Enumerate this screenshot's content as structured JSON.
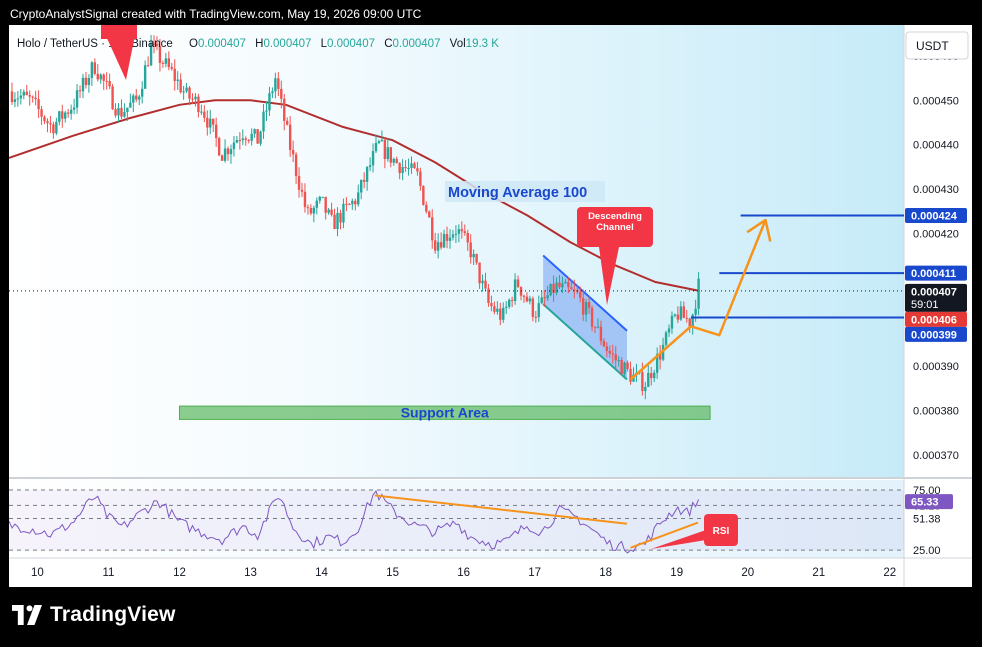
{
  "header": {
    "title": "CryptoAnalystSignal created with TradingView.com, May 19, 2026 09:00 UTC"
  },
  "legend": {
    "symbol": "Holo / TetherUS · 1h · Binance",
    "o_label": "O",
    "o": "0.000407",
    "h_label": "H",
    "h": "0.000407",
    "l_label": "L",
    "l": "0.000407",
    "c_label": "C",
    "c": "0.000407",
    "vol_label": "Vol",
    "vol": "19.3 K"
  },
  "currency": "USDT",
  "colors": {
    "up": "#26a69a",
    "down": "#ef5350",
    "ma": "#b22e2e",
    "blue": "#1848cc",
    "orange": "#f7931a",
    "support": "#66bb6a",
    "rsi": "#7e57c2",
    "callout": "#f23645",
    "bg": "#ddf1fb"
  },
  "annotations": {
    "ma_label": "Moving Average 100",
    "channel_label": "Descending Channel",
    "support_label": "Support Area",
    "rsi_label": "RSI"
  },
  "price_badges": [
    {
      "value": "0.000424",
      "kind": "blue"
    },
    {
      "value": "0.000411",
      "kind": "blue"
    },
    {
      "value": "0.000407",
      "sub": "59:01",
      "kind": "black"
    },
    {
      "value": "0.000406",
      "kind": "red"
    },
    {
      "value": "0.000399",
      "kind": "blue"
    }
  ],
  "rsi_badge": "65.33",
  "rsi_ticks": [
    "75.00",
    "62.20",
    "51.38",
    "25.00"
  ],
  "chart_data": {
    "type": "candlestick",
    "y_ticks": [
      "0.000460",
      "0.000450",
      "0.000440",
      "0.000430",
      "0.000420",
      "0.000390",
      "0.000380",
      "0.000370"
    ],
    "y_range": [
      0.000365,
      0.000467
    ],
    "x_ticks": [
      "10",
      "11",
      "12",
      "13",
      "14",
      "15",
      "16",
      "17",
      "18",
      "19",
      "20",
      "21",
      "22"
    ],
    "x_range_days": [
      9.6,
      22.2
    ],
    "close_path": [
      [
        9.6,
        0.000452
      ],
      [
        9.9,
        0.00045
      ],
      [
        10.2,
        0.000444
      ],
      [
        10.5,
        0.000449
      ],
      [
        10.8,
        0.000458
      ],
      [
        11.0,
        0.000452
      ],
      [
        11.15,
        0.000447
      ],
      [
        11.4,
        0.00045
      ],
      [
        11.6,
        0.000462
      ],
      [
        11.9,
        0.000456
      ],
      [
        12.1,
        0.000451
      ],
      [
        12.3,
        0.000449
      ],
      [
        12.6,
        0.000438
      ],
      [
        12.9,
        0.000443
      ],
      [
        13.1,
        0.000441
      ],
      [
        13.35,
        0.000455
      ],
      [
        13.55,
        0.00044
      ],
      [
        13.8,
        0.000424
      ],
      [
        14.0,
        0.000427
      ],
      [
        14.15,
        0.000422
      ],
      [
        14.5,
        0.000428
      ],
      [
        14.8,
        0.00044
      ],
      [
        15.05,
        0.000436
      ],
      [
        15.35,
        0.000433
      ],
      [
        15.6,
        0.000418
      ],
      [
        15.9,
        0.000421
      ],
      [
        16.1,
        0.000416
      ],
      [
        16.35,
        0.000404
      ],
      [
        16.55,
        0.000401
      ],
      [
        16.75,
        0.000409
      ],
      [
        17.0,
        0.000402
      ],
      [
        17.3,
        0.000408
      ],
      [
        17.6,
        0.000406
      ],
      [
        17.85,
        0.000399
      ],
      [
        18.05,
        0.000393
      ],
      [
        18.35,
        0.000388
      ],
      [
        18.55,
        0.000386
      ],
      [
        18.8,
        0.000394
      ],
      [
        19.0,
        0.000402
      ],
      [
        19.2,
        0.0004
      ],
      [
        19.32,
        0.000409
      ]
    ],
    "ma100": [
      [
        9.6,
        0.000437
      ],
      [
        10.5,
        0.000442
      ],
      [
        11.3,
        0.000446
      ],
      [
        12.0,
        0.000449
      ],
      [
        12.5,
        0.00045
      ],
      [
        13.0,
        0.00045
      ],
      [
        13.5,
        0.000449
      ],
      [
        14.3,
        0.000444
      ],
      [
        15.0,
        0.000441
      ],
      [
        15.6,
        0.000436
      ],
      [
        16.2,
        0.00043
      ],
      [
        16.9,
        0.000424
      ],
      [
        17.5,
        0.000418
      ],
      [
        18.1,
        0.000413
      ],
      [
        18.7,
        0.000409
      ],
      [
        19.32,
        0.000407
      ]
    ],
    "moving_average_period": 100,
    "descending_channel": {
      "upper": [
        [
          17.12,
          0.000415
        ],
        [
          18.3,
          0.000398
        ]
      ],
      "lower": [
        [
          17.12,
          0.000404
        ],
        [
          18.3,
          0.000387
        ]
      ]
    },
    "support_area": {
      "from": 0.000378,
      "to": 0.000381,
      "x_start": 12.0,
      "x_end": 19.47
    },
    "projection": [
      [
        18.35,
        0.000387
      ],
      [
        19.2,
        0.000399
      ],
      [
        19.6,
        0.000397
      ],
      [
        20.25,
        0.000423
      ]
    ],
    "levels": [
      {
        "value": 0.000424,
        "x_start": 19.9
      },
      {
        "value": 0.000411,
        "x_start": 19.6
      },
      {
        "value": 0.000401,
        "x_start": 19.2
      }
    ],
    "last_price": 0.000407,
    "rsi": {
      "y_range": [
        21,
        80
      ],
      "levels": [
        75,
        62.2,
        51.38,
        25
      ],
      "path": [
        [
          9.6,
          46
        ],
        [
          9.9,
          43
        ],
        [
          10.2,
          38
        ],
        [
          10.5,
          48
        ],
        [
          10.8,
          70
        ],
        [
          11.0,
          52
        ],
        [
          11.2,
          44
        ],
        [
          11.5,
          58
        ],
        [
          11.7,
          66
        ],
        [
          12.0,
          48
        ],
        [
          12.3,
          40
        ],
        [
          12.6,
          34
        ],
        [
          12.9,
          45
        ],
        [
          13.1,
          38
        ],
        [
          13.4,
          72
        ],
        [
          13.6,
          44
        ],
        [
          13.85,
          30
        ],
        [
          14.1,
          36
        ],
        [
          14.3,
          32
        ],
        [
          14.5,
          42
        ],
        [
          14.75,
          74
        ],
        [
          15.0,
          58
        ],
        [
          15.3,
          46
        ],
        [
          15.6,
          40
        ],
        [
          15.9,
          48
        ],
        [
          16.1,
          36
        ],
        [
          16.4,
          30
        ],
        [
          16.6,
          32
        ],
        [
          16.9,
          46
        ],
        [
          17.1,
          40
        ],
        [
          17.35,
          58
        ],
        [
          17.6,
          52
        ],
        [
          17.85,
          40
        ],
        [
          18.05,
          30
        ],
        [
          18.3,
          27
        ],
        [
          18.55,
          30
        ],
        [
          18.8,
          50
        ],
        [
          19.0,
          60
        ],
        [
          19.15,
          56
        ],
        [
          19.32,
          67
        ]
      ],
      "trendline": [
        [
          14.75,
          70.5
        ],
        [
          18.3,
          47
        ]
      ],
      "arrow": [
        [
          18.35,
          27
        ],
        [
          19.3,
          48
        ]
      ]
    }
  }
}
